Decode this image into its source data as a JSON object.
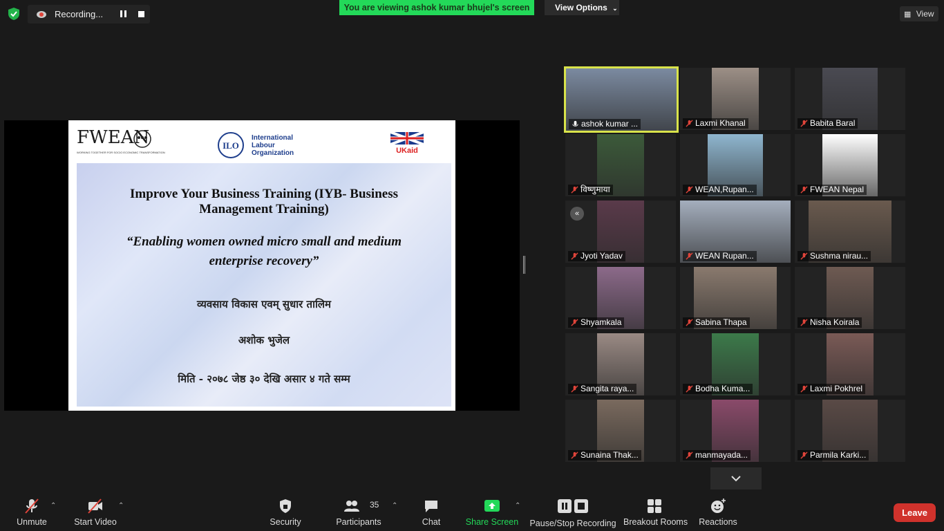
{
  "topbar": {
    "recording_label": "Recording...",
    "viewing_banner": "You are viewing ashok kumar bhujel's screen",
    "view_options_label": "View Options",
    "view_label": "View"
  },
  "slide": {
    "logo_fwean": "FWEAN",
    "logo_fwean_sub": "WORKING TOGETHER FOR SOCIO ECONOMIC TRANSFORMATION",
    "logo_ilo": "International Labour Organization",
    "logo_ukaid": "UKaid",
    "title": "Improve Your Business Training (IYB- Business Management Training)",
    "subtitle": "“Enabling women owned micro small and medium enterprise recovery”",
    "devanagari_line1": "व्यवसाय विकास एवम् सुधार तालिम",
    "devanagari_line2": "अशोक भुजेल",
    "devanagari_line3": "मिति - २०७८ जेष्ठ ३० देखि असार ४ गते सम्म"
  },
  "participants": [
    {
      "name": "ashok kumar ...",
      "active": true
    },
    {
      "name": "Laxmi Khanal"
    },
    {
      "name": "Babita Baral"
    },
    {
      "name": "विष्णुमाया"
    },
    {
      "name": "WEAN,Rupan..."
    },
    {
      "name": "FWEAN Nepal"
    },
    {
      "name": "Jyoti Yadav"
    },
    {
      "name": "WEAN Rupan..."
    },
    {
      "name": "Sushma nirau..."
    },
    {
      "name": "Shyamkala"
    },
    {
      "name": "Sabina Thapa"
    },
    {
      "name": "Nisha Koirala"
    },
    {
      "name": "Sangita raya..."
    },
    {
      "name": "Bodha Kuma..."
    },
    {
      "name": "Laxmi Pokhrel"
    },
    {
      "name": "Sunaina Thak..."
    },
    {
      "name": "manmayada..."
    },
    {
      "name": "Parmila Karki..."
    }
  ],
  "toolbar": {
    "unmute": "Unmute",
    "start_video": "Start Video",
    "security": "Security",
    "participants": "Participants",
    "participants_count": "35",
    "chat": "Chat",
    "share_screen": "Share Screen",
    "pause_stop_recording": "Pause/Stop Recording",
    "breakout_rooms": "Breakout Rooms",
    "reactions": "Reactions",
    "leave": "Leave"
  },
  "colors": {
    "banner_green": "#23d959",
    "active_speaker_border": "#d9e34a",
    "share_green": "#23d959",
    "leave_red": "#d0322c",
    "mute_red": "#e0443a"
  }
}
